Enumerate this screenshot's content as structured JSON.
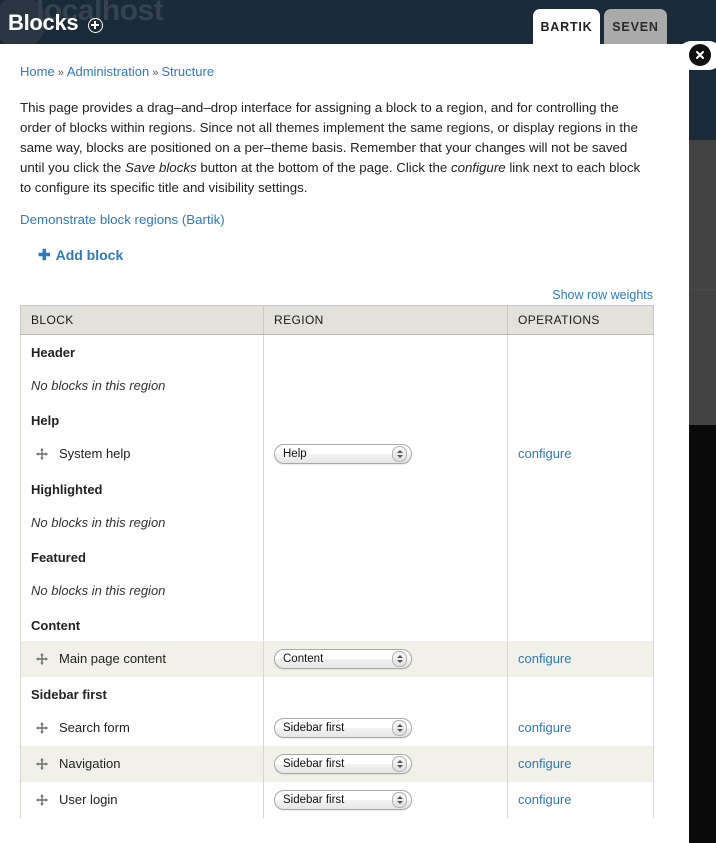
{
  "window": {
    "watermark": "localhost",
    "app_title": "Blocks",
    "title_icon": "circle-plus-icon",
    "close_icon": "close-x-icon"
  },
  "theme_tabs": [
    {
      "label": "BARTIK",
      "active": true
    },
    {
      "label": "SEVEN",
      "active": false
    }
  ],
  "breadcrumb": {
    "items": [
      "Home",
      "Administration",
      "Structure"
    ],
    "separator": "»"
  },
  "intro": {
    "part1": "This page provides a drag–and–drop interface for assigning a block to a region, and for controlling the order of blocks within regions. Since not all themes implement the same regions, or display regions in the same way, blocks are positioned on a per–theme basis. Remember that your changes will not be saved until you click the ",
    "em1": "Save blocks",
    "part2": " button at the bottom of the page. Click the ",
    "em2": "configure",
    "part3": " link next to each block to configure its specific title and visibility settings."
  },
  "demo_link": "Demonstrate block regions (Bartik)",
  "add_block": {
    "label": "Add block",
    "plus": "➕"
  },
  "show_row_weights": "Show row weights",
  "table": {
    "headers": [
      "BLOCK",
      "REGION",
      "OPERATIONS"
    ],
    "empty_text": "No blocks in this region",
    "configure_label": "configure",
    "rows": [
      {
        "kind": "region",
        "region": "Header"
      },
      {
        "kind": "empty"
      },
      {
        "kind": "region",
        "region": "Help"
      },
      {
        "kind": "block",
        "name": "System help",
        "selected_region": "Help",
        "stripe": false
      },
      {
        "kind": "region",
        "region": "Highlighted"
      },
      {
        "kind": "empty"
      },
      {
        "kind": "region",
        "region": "Featured"
      },
      {
        "kind": "empty"
      },
      {
        "kind": "region",
        "region": "Content"
      },
      {
        "kind": "block",
        "name": "Main page content",
        "selected_region": "Content",
        "stripe": true
      },
      {
        "kind": "region",
        "region": "Sidebar first"
      },
      {
        "kind": "block",
        "name": "Search form",
        "selected_region": "Sidebar first",
        "stripe": false
      },
      {
        "kind": "block",
        "name": "Navigation",
        "selected_region": "Sidebar first",
        "stripe": true
      },
      {
        "kind": "block",
        "name": "User login",
        "selected_region": "Sidebar first",
        "stripe": false
      }
    ]
  },
  "colors": {
    "chrome": "#1b2a38",
    "link": "#2c7bbf",
    "header_bg": "#e2e1dc",
    "stripe": "#f1f1ea",
    "tab_inactive": "#aaaaaa"
  }
}
